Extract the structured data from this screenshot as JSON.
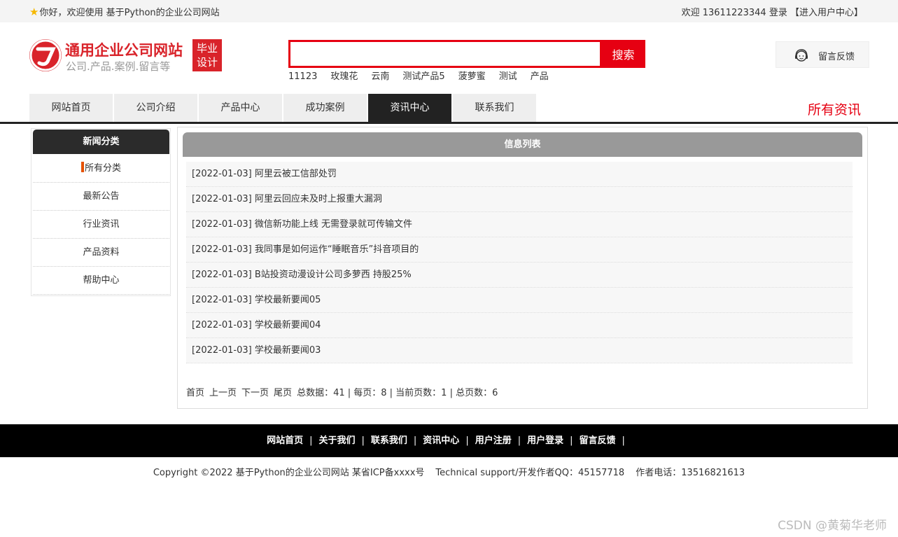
{
  "topbar": {
    "greeting": "你好，欢迎使用 基于Python的企业公司网站",
    "welcome": "欢迎 13611223344",
    "login": "登录",
    "user_center": "【进入用户中心】"
  },
  "logo": {
    "name": "通用企业公司网站",
    "subtitle": "公司.产品.案例.留言等",
    "badge_line1": "毕业",
    "badge_line2": "设计"
  },
  "search": {
    "value": "",
    "button_label": "搜索",
    "hotwords": [
      "11123",
      "玫瑰花",
      "云南",
      "测试产品5",
      "菠萝蜜",
      "测试",
      "产品"
    ]
  },
  "feedback": {
    "label": "留言反馈",
    "icon": "customer-service-icon"
  },
  "nav": {
    "tabs": [
      "网站首页",
      "公司介绍",
      "产品中心",
      "成功案例",
      "资讯中心",
      "联系我们"
    ],
    "active_index": 4,
    "page_label": "所有资讯"
  },
  "sidebar": {
    "title": "新闻分类",
    "items": [
      "所有分类",
      "最新公告",
      "行业资讯",
      "产品资料",
      "帮助中心"
    ]
  },
  "list": {
    "title": "信息列表",
    "items": [
      "[2022-01-03] 阿里云被工信部处罚",
      "[2022-01-03] 阿里云回应未及时上报重大漏洞",
      "[2022-01-03] 微信新功能上线 无需登录就可传输文件",
      "[2022-01-03] 我同事是如何运作“睡眠音乐”抖音项目的",
      "[2022-01-03] B站投资动漫设计公司多萝西 持股25%",
      "[2022-01-03] 学校最新要闻05",
      "[2022-01-03] 学校最新要闻04",
      "[2022-01-03] 学校最新要闻03"
    ]
  },
  "pager": {
    "first": "首页",
    "prev": "上一页",
    "next": "下一页",
    "last": "尾页",
    "summary": "总数据：41 | 每页：8 | 当前页数：1 | 总页数：6"
  },
  "footer": {
    "links": [
      "网站首页",
      "关于我们",
      "联系我们",
      "资讯中心",
      "用户注册",
      "用户登录",
      "留言反馈"
    ],
    "copyright": "Copyright ©2022 基于Python的企业公司网站 某省ICP备xxxx号",
    "support": "Technical support/开发作者QQ：45157718",
    "phone": "作者电话：13516821613"
  },
  "watermark": "CSDN @黄菊华老师",
  "colors": {
    "brand_red": "#e60012",
    "dark": "#222222",
    "list_header": "#999999"
  }
}
